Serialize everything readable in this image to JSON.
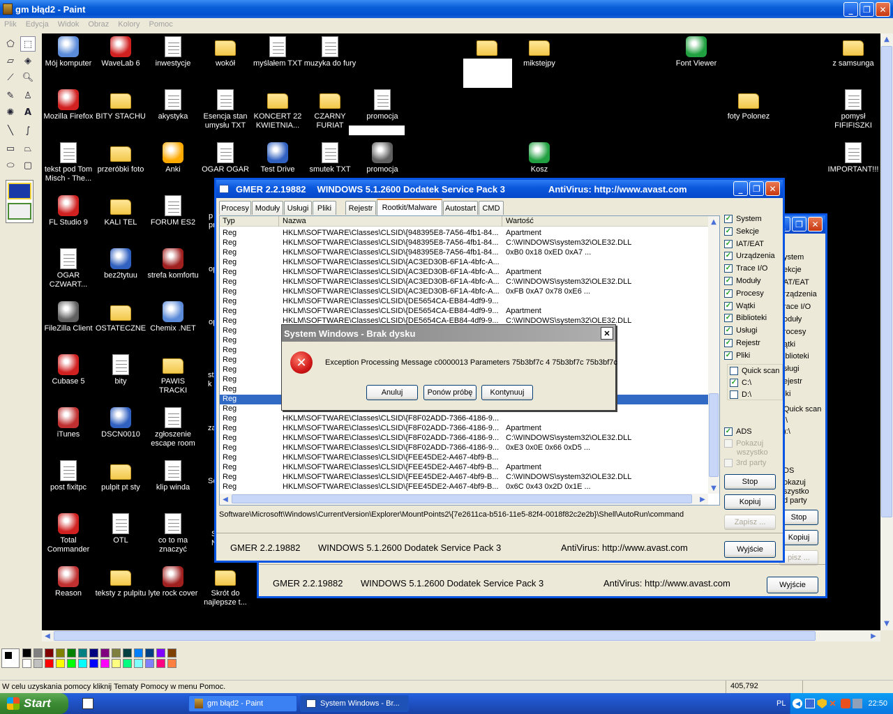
{
  "paint": {
    "title": "gm błąd2 - Paint",
    "menu": [
      "Plik",
      "Edycja",
      "Widok",
      "Obraz",
      "Kolory",
      "Pomoc"
    ],
    "status_help": "W celu uzyskania pomocy kliknij Tematy Pomocy w menu Pomoc.",
    "status_coords": "405,792",
    "palette_colors": [
      "#000000",
      "#808080",
      "#800000",
      "#808000",
      "#008000",
      "#008080",
      "#000080",
      "#800080",
      "#808040",
      "#004040",
      "#0080ff",
      "#004080",
      "#8000ff",
      "#804000",
      "#ffffff",
      "#c0c0c0",
      "#ff0000",
      "#ffff00",
      "#00ff00",
      "#00ffff",
      "#0000ff",
      "#ff00ff",
      "#ffff80",
      "#00ff80",
      "#80ffff",
      "#8080ff",
      "#ff0080",
      "#ff8040"
    ]
  },
  "desktop": {
    "icons": [
      {
        "label": "Mój komputer",
        "type": "app"
      },
      {
        "label": "WaveLab 6",
        "type": "app"
      },
      {
        "label": "inwestycje",
        "type": "doc"
      },
      {
        "label": "wokół",
        "type": "folder"
      },
      {
        "label": "myślałem TXT",
        "type": "doc"
      },
      {
        "label": "muzyka do fury",
        "type": "doc"
      },
      {
        "label": "",
        "type": "folder"
      },
      {
        "label": "mikstejpy",
        "type": "folder"
      },
      {
        "label": "Font Viewer",
        "type": "app"
      },
      {
        "label": "z samsunga",
        "type": "folder"
      },
      {
        "label": "Mozilla Firefox",
        "type": "app"
      },
      {
        "label": "BITY STACHU",
        "type": "folder"
      },
      {
        "label": "akystyka",
        "type": "doc"
      },
      {
        "label": "Esencja stan umysłu TXT",
        "type": "doc"
      },
      {
        "label": "KONCERT 22 KWIETNIA...",
        "type": "folder"
      },
      {
        "label": "CZARNY FURIAT",
        "type": "folder"
      },
      {
        "label": "promocja",
        "type": "doc"
      },
      {
        "label": "foty Polonez",
        "type": "folder"
      },
      {
        "label": "pomysł FIFIFISZKI",
        "type": "doc"
      },
      {
        "label": "tekst pod Tom Misch - The...",
        "type": "doc"
      },
      {
        "label": "przeróbki foto",
        "type": "folder"
      },
      {
        "label": "Anki",
        "type": "app"
      },
      {
        "label": "OGAR OGAR",
        "type": "doc"
      },
      {
        "label": "Test Drive",
        "type": "app"
      },
      {
        "label": "smutek TXT",
        "type": "doc"
      },
      {
        "label": "promocja",
        "type": "app"
      },
      {
        "label": "Kosz",
        "type": "app"
      },
      {
        "label": "IMPORTANT!!!",
        "type": "doc"
      },
      {
        "label": "FL Studio 9",
        "type": "app"
      },
      {
        "label": "KALI TEL",
        "type": "folder"
      },
      {
        "label": "FORUM ES2",
        "type": "doc"
      },
      {
        "label": "OGAR CZWART...",
        "type": "doc"
      },
      {
        "label": "bez2tytuu",
        "type": "app"
      },
      {
        "label": "strefa komfortu",
        "type": "app"
      },
      {
        "label": "FileZilla Client",
        "type": "app"
      },
      {
        "label": "OSTATECZNE",
        "type": "folder"
      },
      {
        "label": "Chemix .NET",
        "type": "app"
      },
      {
        "label": "Cubase 5",
        "type": "app"
      },
      {
        "label": "bity",
        "type": "doc"
      },
      {
        "label": "PAWIS TRACKI",
        "type": "folder"
      },
      {
        "label": "iTunes",
        "type": "app"
      },
      {
        "label": "DSCN0010",
        "type": "app"
      },
      {
        "label": "zgłoszenie escape room",
        "type": "doc"
      },
      {
        "label": "post fixitpc",
        "type": "doc"
      },
      {
        "label": "pulpit pt sty",
        "type": "folder"
      },
      {
        "label": "klip winda",
        "type": "doc"
      },
      {
        "label": "Total Commander",
        "type": "app"
      },
      {
        "label": "OTL",
        "type": "doc"
      },
      {
        "label": "co to ma znaczyć",
        "type": "doc"
      },
      {
        "label": "Reason",
        "type": "app"
      },
      {
        "label": "teksty z pulpitu",
        "type": "folder"
      },
      {
        "label": "lyte rock cover",
        "type": "app"
      },
      {
        "label": "Skrót do najlepsze t...",
        "type": "folder"
      }
    ],
    "partial_labels": [
      "p",
      "pr",
      "op",
      "ope",
      "stu",
      "k",
      "zap",
      "Sc",
      "S",
      "NA"
    ]
  },
  "gmer_back": {
    "footer_version": "GMER 2.2.19882",
    "footer_os": "WINDOWS 5.1.2600 Dodatek Service Pack 3",
    "footer_av": "AntiVirus: http://www.avast.com",
    "exit_label": "Wyjście",
    "side_items": [
      "ystem",
      "ekcje",
      "AT/EAT",
      "rządzenia",
      "race I/O",
      "oduły",
      "rocesy",
      "ątki",
      "iblioteki",
      "sługi",
      "ejestr",
      "iki"
    ],
    "quick_scan": "Quick scan",
    "drive_c": ":\\",
    "drive_d": "):\\",
    "ads": "DS",
    "pokazuj": "okazuj",
    "wszystko": "szystko",
    "party": "d party",
    "stop_label": "Stop",
    "copy_label": "Kopiuj",
    "save_label": "pisz ..."
  },
  "gmer": {
    "title_app": "GMER 2.2.19882",
    "title_os": "WINDOWS 5.1.2600 Dodatek Service Pack 3",
    "title_av": "AntiVirus: http://www.avast.com",
    "tabs": [
      "Procesy",
      "Moduły",
      "Usługi",
      "Pliki",
      "Rejestr",
      "Rootkit/Malware",
      "Autostart",
      "CMD"
    ],
    "columns": [
      "Typ",
      "Nazwa",
      "Wartość"
    ],
    "rows": [
      [
        "Reg",
        "HKLM\\SOFTWARE\\Classes\\CLSID\\{948395E8-7A56-4fb1-84...",
        "Apartment"
      ],
      [
        "Reg",
        "HKLM\\SOFTWARE\\Classes\\CLSID\\{948395E8-7A56-4fb1-84...",
        "C:\\WINDOWS\\system32\\OLE32.DLL"
      ],
      [
        "Reg",
        "HKLM\\SOFTWARE\\Classes\\CLSID\\{948395E8-7A56-4fb1-84...",
        "0xB0 0x18 0xED 0xA7 ..."
      ],
      [
        "Reg",
        "HKLM\\SOFTWARE\\Classes\\CLSID\\{AC3ED30B-6F1A-4bfc-A...",
        ""
      ],
      [
        "Reg",
        "HKLM\\SOFTWARE\\Classes\\CLSID\\{AC3ED30B-6F1A-4bfc-A...",
        "Apartment"
      ],
      [
        "Reg",
        "HKLM\\SOFTWARE\\Classes\\CLSID\\{AC3ED30B-6F1A-4bfc-A...",
        "C:\\WINDOWS\\system32\\OLE32.DLL"
      ],
      [
        "Reg",
        "HKLM\\SOFTWARE\\Classes\\CLSID\\{AC3ED30B-6F1A-4bfc-A...",
        "0xFB 0xA7 0x78 0xE6 ..."
      ],
      [
        "Reg",
        "HKLM\\SOFTWARE\\Classes\\CLSID\\{DE5654CA-EB84-4df9-9...",
        ""
      ],
      [
        "Reg",
        "HKLM\\SOFTWARE\\Classes\\CLSID\\{DE5654CA-EB84-4df9-9...",
        "Apartment"
      ],
      [
        "Reg",
        "HKLM\\SOFTWARE\\Classes\\CLSID\\{DE5654CA-EB84-4df9-9...",
        "C:\\WINDOWS\\system32\\OLE32.DLL"
      ],
      [
        "Reg",
        "",
        ""
      ],
      [
        "Reg",
        "",
        ""
      ],
      [
        "Reg",
        "",
        ""
      ],
      [
        "Reg",
        "",
        "...DLL"
      ],
      [
        "Reg",
        "",
        ""
      ],
      [
        "Reg",
        "",
        ""
      ],
      [
        "Reg",
        "",
        ""
      ],
      [
        "Reg",
        "",
        "...DLL"
      ],
      [
        "Reg",
        "",
        ""
      ],
      [
        "Reg",
        "HKLM\\SOFTWARE\\Classes\\CLSID\\{F8F02ADD-7366-4186-9...",
        ""
      ],
      [
        "Reg",
        "HKLM\\SOFTWARE\\Classes\\CLSID\\{F8F02ADD-7366-4186-9...",
        "Apartment"
      ],
      [
        "Reg",
        "HKLM\\SOFTWARE\\Classes\\CLSID\\{F8F02ADD-7366-4186-9...",
        "C:\\WINDOWS\\system32\\OLE32.DLL"
      ],
      [
        "Reg",
        "HKLM\\SOFTWARE\\Classes\\CLSID\\{F8F02ADD-7366-4186-9...",
        "0xE3 0x0E 0x66 0xD5 ..."
      ],
      [
        "Reg",
        "HKLM\\SOFTWARE\\Classes\\CLSID\\{FEE45DE2-A467-4bf9-B...",
        ""
      ],
      [
        "Reg",
        "HKLM\\SOFTWARE\\Classes\\CLSID\\{FEE45DE2-A467-4bf9-B...",
        "Apartment"
      ],
      [
        "Reg",
        "HKLM\\SOFTWARE\\Classes\\CLSID\\{FEE45DE2-A467-4bf9-B...",
        "C:\\WINDOWS\\system32\\OLE32.DLL"
      ],
      [
        "Reg",
        "HKLM\\SOFTWARE\\Classes\\CLSID\\{FEE45DE2-A467-4bf9-B...",
        "0x6C 0x43 0x2D 0x1E ..."
      ]
    ],
    "selected_row": 17,
    "path": "Software\\Microsoft\\Windows\\CurrentVersion\\Explorer\\MountPoints2\\{7e2611ca-b516-11e5-82f4-0018f82c2e2b}\\Shell\\AutoRun\\command",
    "checks": [
      {
        "label": "System",
        "checked": true
      },
      {
        "label": "Sekcje",
        "checked": true
      },
      {
        "label": "IAT/EAT",
        "checked": true
      },
      {
        "label": "Urządzenia",
        "checked": true
      },
      {
        "label": "Trace I/O",
        "checked": true
      },
      {
        "label": "Moduły",
        "checked": true
      },
      {
        "label": "Procesy",
        "checked": true
      },
      {
        "label": "Wątki",
        "checked": true
      },
      {
        "label": "Biblioteki",
        "checked": true
      },
      {
        "label": "Usługi",
        "checked": true
      },
      {
        "label": "Rejestr",
        "checked": true
      },
      {
        "label": "Pliki",
        "checked": true
      }
    ],
    "quick_scan": "Quick scan",
    "drive_c": "C:\\",
    "drive_d": "D:\\",
    "ads": "ADS",
    "pokazuj": "Pokazuj",
    "wszystko": "wszystko",
    "third_party": "3rd party",
    "stop_label": "Stop",
    "copy_label": "Kopiuj",
    "save_label": "Zapisz ...",
    "exit_label": "Wyjście"
  },
  "dialog": {
    "title": "System Windows - Brak dysku",
    "message": "Exception Processing Message c0000013 Parameters 75b3bf7c 4 75b3bf7c 75b3bf7c",
    "cancel": "Anuluj",
    "retry": "Ponów próbę",
    "continue": "Kontynuuj"
  },
  "taskbar": {
    "start": "Start",
    "tasks": [
      "gm błąd2 - Paint",
      "System Windows - Br..."
    ],
    "lang": "PL",
    "clock": "22:50"
  }
}
